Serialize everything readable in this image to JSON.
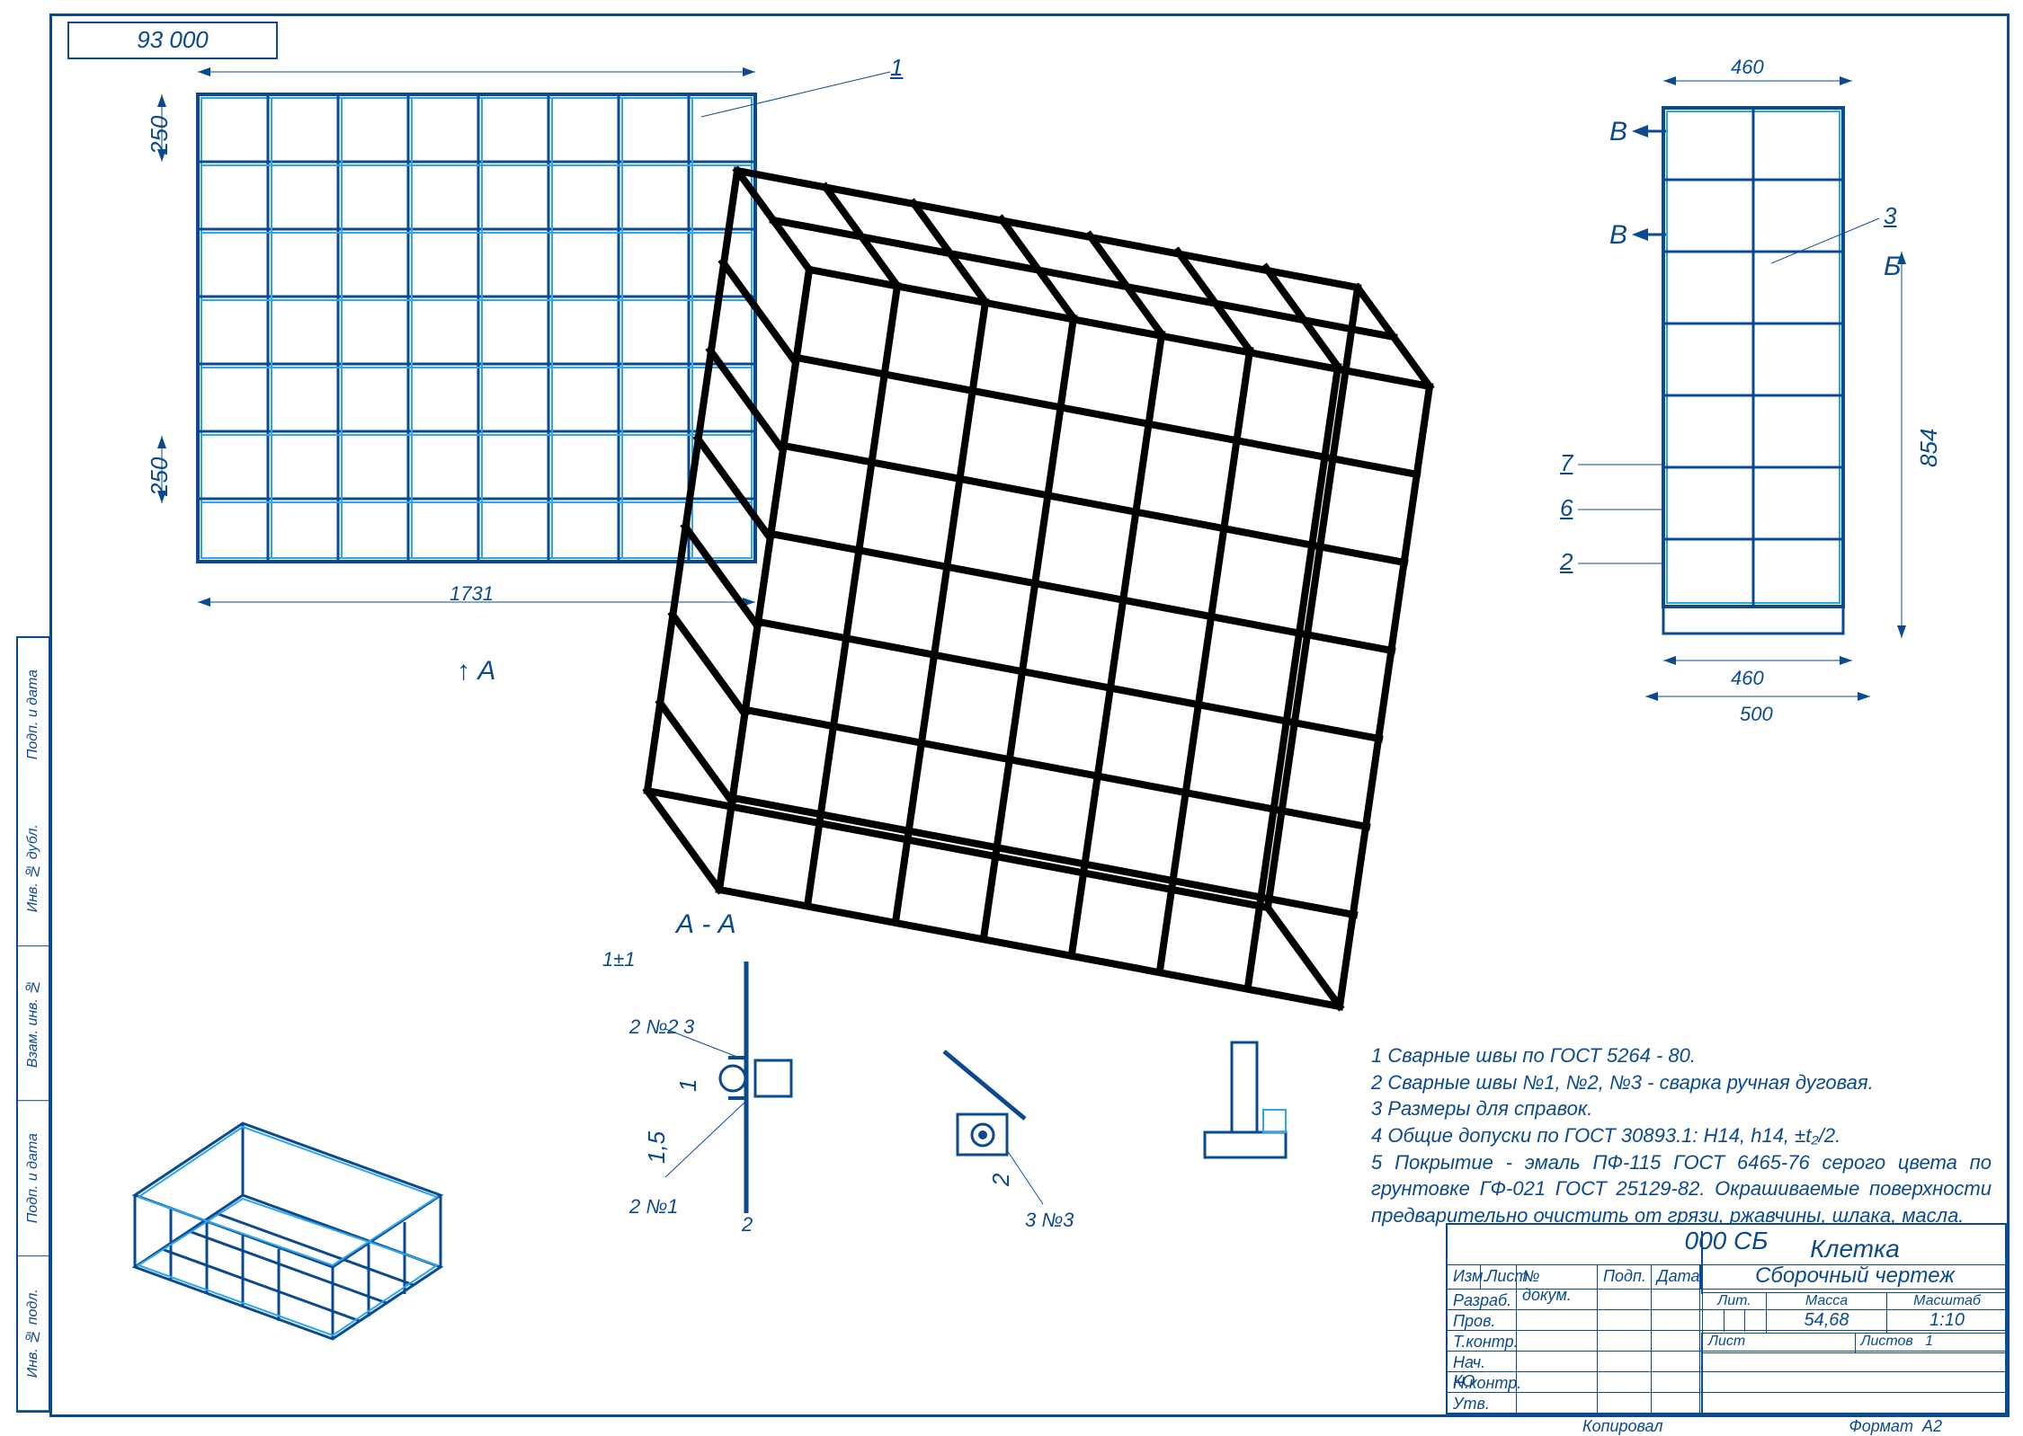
{
  "drawing_id": "93 000",
  "meta": {
    "company_code": "000 СБ",
    "title_line1": "Клетка",
    "title_line2": "Сборочный чертеж",
    "bottom_kopiroval": "Копировал",
    "bottom_format": "Формат",
    "format_value": "А2"
  },
  "dimensions": {
    "front_width": "1731",
    "front_v1": "250",
    "front_v2": "250",
    "side_top": "460",
    "side_bottom": "460",
    "side_overall": "500",
    "side_height": "854",
    "detailA_gap": "1",
    "detailA_off": "1,5",
    "detailA_edge": "2",
    "detailB_off": "2",
    "toler": "1±1"
  },
  "section_labels": {
    "A_arrow": "А",
    "A_section": "А - А",
    "B_top": "В",
    "B_mid": "В",
    "B_letter": "Б"
  },
  "weld_labels": {
    "w1": "2 №1",
    "w2": "2 №2",
    "w3": "3",
    "w4": "3 №3"
  },
  "balloons": {
    "b1": "1",
    "b2": "2",
    "b3": "3",
    "b6": "6",
    "b7": "7"
  },
  "notes": {
    "n1": "1 Сварные швы по ГОСТ 5264 - 80.",
    "n2": "2 Сварные швы №1, №2, №3 - сварка ручная дуговая.",
    "n3": "3 Размеры для справок.",
    "n4": "4 Общие допуски по ГОСТ 30893.1: H14, h14, ±t₂/2.",
    "n5": "5 Покрытие - эмаль ПФ-115  ГОСТ 6465-76 серого цвета по грунтовке ГФ-021 ГОСТ 25129-82. Окрашиваемые поверхности предварительно очистить от грязи, ржавчины, шлака, масла."
  },
  "titleblock": {
    "hdr_izm": "Изм.",
    "hdr_list": "Лист",
    "hdr_docnum": "№ докум.",
    "hdr_podp": "Подп.",
    "hdr_data": "Дата",
    "row_razrab": "Разраб.",
    "row_prov": "Пров.",
    "row_tkontr": "Т.контр.",
    "row_nachko": "Нач. КО",
    "row_nkontr": "Н.контр.",
    "row_utv": "Утв.",
    "hdr_lit": "Лит.",
    "hdr_massa": "Масса",
    "hdr_masshtab": "Масштаб",
    "val_massa": "54,68",
    "val_masshtab": "1:10",
    "hdr_list2": "Лист",
    "hdr_listov": "Листов",
    "val_listov": "1"
  },
  "sidecol": {
    "s1": "Инв. № подл.",
    "s2": "Подп. и дата",
    "s3": "Взам. инв. №",
    "s4": "Инв. № дубл.",
    "s5": "Подп. и дата"
  }
}
